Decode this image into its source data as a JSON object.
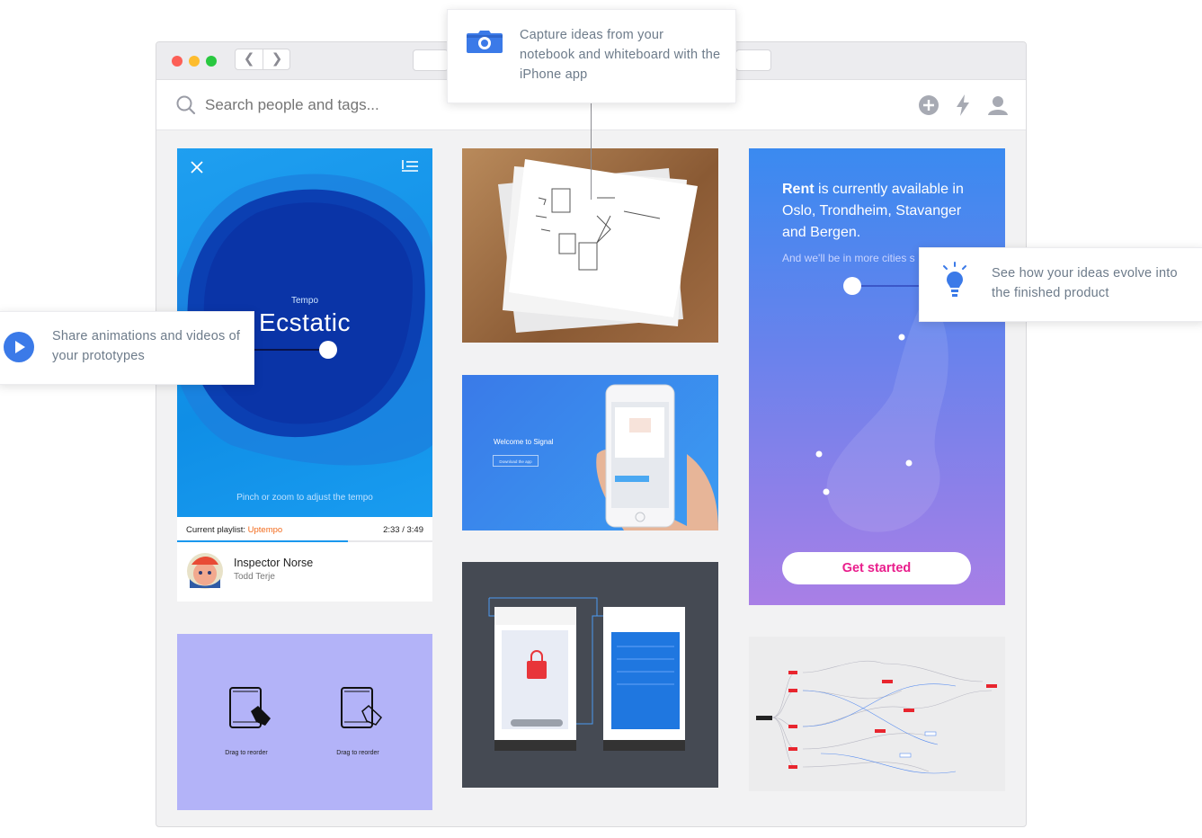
{
  "search": {
    "placeholder": "Search people and tags..."
  },
  "callouts": {
    "capture": "Capture ideas from your notebook and whiteboard with the iPhone app",
    "share": "Share animations and videos of your prototypes",
    "evolve": "See how your ideas evolve into the finished product"
  },
  "tempo_card": {
    "label": "Tempo",
    "value": "Ecstatic",
    "hint": "Pinch or zoom to adjust the tempo",
    "playlist_prefix": "Current playlist: ",
    "playlist_name": "Uptempo",
    "time": "2:33 / 3:49",
    "track_title": "Inspector Norse",
    "track_artist": "Todd Terje",
    "progress": 0.67
  },
  "signal_card": {
    "title": "Welcome to Signal",
    "button": "Download the app"
  },
  "rent_card": {
    "brand": "Rent",
    "text": " is currently available in Oslo, Trondheim, Stavanger and Bergen.",
    "sub": "And we'll be in more cities s",
    "button": "Get started"
  },
  "drag_card": {
    "left_label": "Drag to reorder",
    "right_label": "Drag to reorder"
  },
  "colors": {
    "accent_blue": "#3b7ae8",
    "tempo_blue": "#1a98ee",
    "playlist_orange": "#f26b1d",
    "rent_pink": "#e91e8c",
    "drag_purple": "#b3b3f8",
    "flow_dark": "#454a53"
  }
}
